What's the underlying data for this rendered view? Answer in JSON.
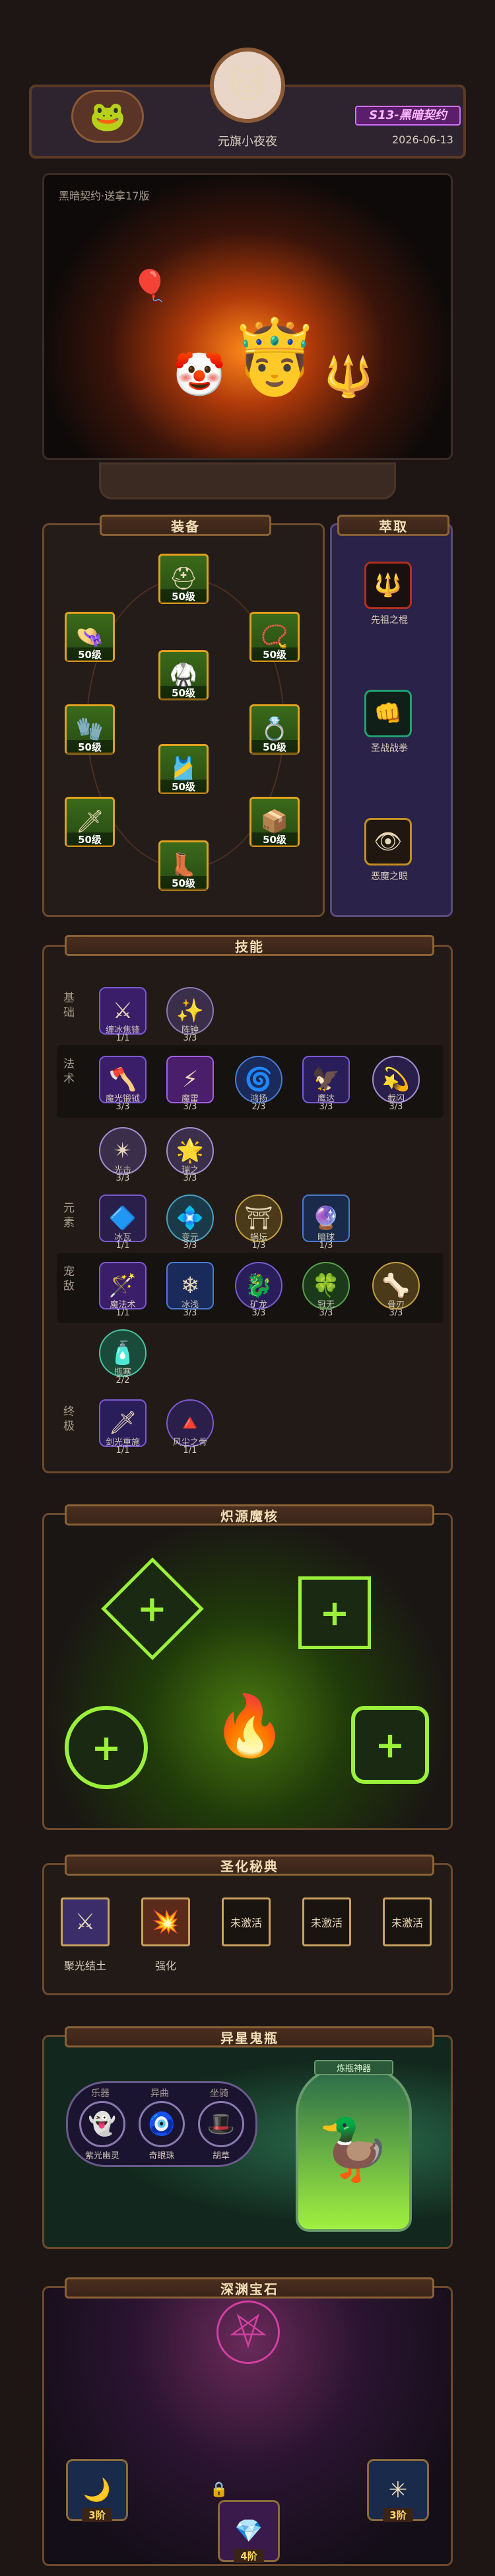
{
  "header": {
    "player_name": "元旗小夜夜",
    "season_badge": "S13-黑暗契约",
    "date": "2026-06-13"
  },
  "hero": {
    "subtitle": "黑暗契约·送拿17版"
  },
  "equipment": {
    "title": "装备",
    "items": [
      {
        "level": "50级"
      },
      {
        "level": "50级"
      },
      {
        "level": "50级"
      },
      {
        "level": "50级"
      },
      {
        "level": "50级"
      },
      {
        "level": "50级"
      },
      {
        "level": "50级"
      },
      {
        "level": "50级"
      },
      {
        "level": "50级"
      },
      {
        "level": "50级"
      }
    ]
  },
  "extract": {
    "title": "萃取",
    "items": [
      {
        "name": "先祖之棍"
      },
      {
        "name": "圣战战拳"
      },
      {
        "name": "恶魔之眼"
      }
    ]
  },
  "skills": {
    "title": "技能",
    "groups": [
      {
        "label": "基础",
        "items": [
          {
            "name": "缠冰焦锋",
            "count": "1/1"
          },
          {
            "name": "阵钟",
            "count": "3/3"
          }
        ]
      },
      {
        "label": "法术",
        "items": [
          {
            "name": "魔光锻钺",
            "count": "3/3"
          },
          {
            "name": "魔雷",
            "count": "3/3"
          },
          {
            "name": "鸿扬",
            "count": "2/3"
          },
          {
            "name": "鹰达",
            "count": "3/3"
          },
          {
            "name": "截闪",
            "count": "3/3"
          },
          {
            "name": "光击",
            "count": "3/3"
          },
          {
            "name": "瑞之",
            "count": "3/3"
          }
        ]
      },
      {
        "label": "元素",
        "items": [
          {
            "name": "冰瓦",
            "count": "1/1"
          },
          {
            "name": "变元",
            "count": "3/3"
          },
          {
            "name": "蜗坛",
            "count": "1/3"
          },
          {
            "name": "暗球",
            "count": "1/3"
          }
        ]
      },
      {
        "label": "宠敌",
        "items": [
          {
            "name": "魔法术",
            "count": "1/1"
          },
          {
            "name": "冰浅",
            "count": "3/3"
          },
          {
            "name": "矿龙",
            "count": "3/3"
          },
          {
            "name": "冠无",
            "count": "3/3"
          },
          {
            "name": "骨刃",
            "count": "3/3"
          },
          {
            "name": "瓶塞",
            "count": "2/2"
          }
        ]
      },
      {
        "label": "终极",
        "items": [
          {
            "name": "剑光重施",
            "count": "1/1"
          },
          {
            "name": "风尘之骨",
            "count": "1/1"
          }
        ]
      }
    ]
  },
  "core": {
    "title": "炽源魔核"
  },
  "sacred": {
    "title": "圣化秘典",
    "items": [
      {
        "name": "聚光结土",
        "state": ""
      },
      {
        "name": "强化",
        "state": ""
      },
      {
        "name": "",
        "state": "未激活"
      },
      {
        "name": "",
        "state": "未激活"
      },
      {
        "name": "",
        "state": "未激活"
      }
    ]
  },
  "pets": {
    "title": "异星鬼瓶",
    "left_labels": [
      "乐器",
      "异曲",
      "坐骑"
    ],
    "left_items": [
      "紫光幽灵",
      "奇眼珠",
      "胡草"
    ],
    "right_label": "炼瓶神器"
  },
  "gems": {
    "title": "深渊宝石",
    "items": [
      {
        "rank": "3阶"
      },
      {
        "rank": "4阶"
      },
      {
        "rank": "3阶"
      }
    ]
  }
}
